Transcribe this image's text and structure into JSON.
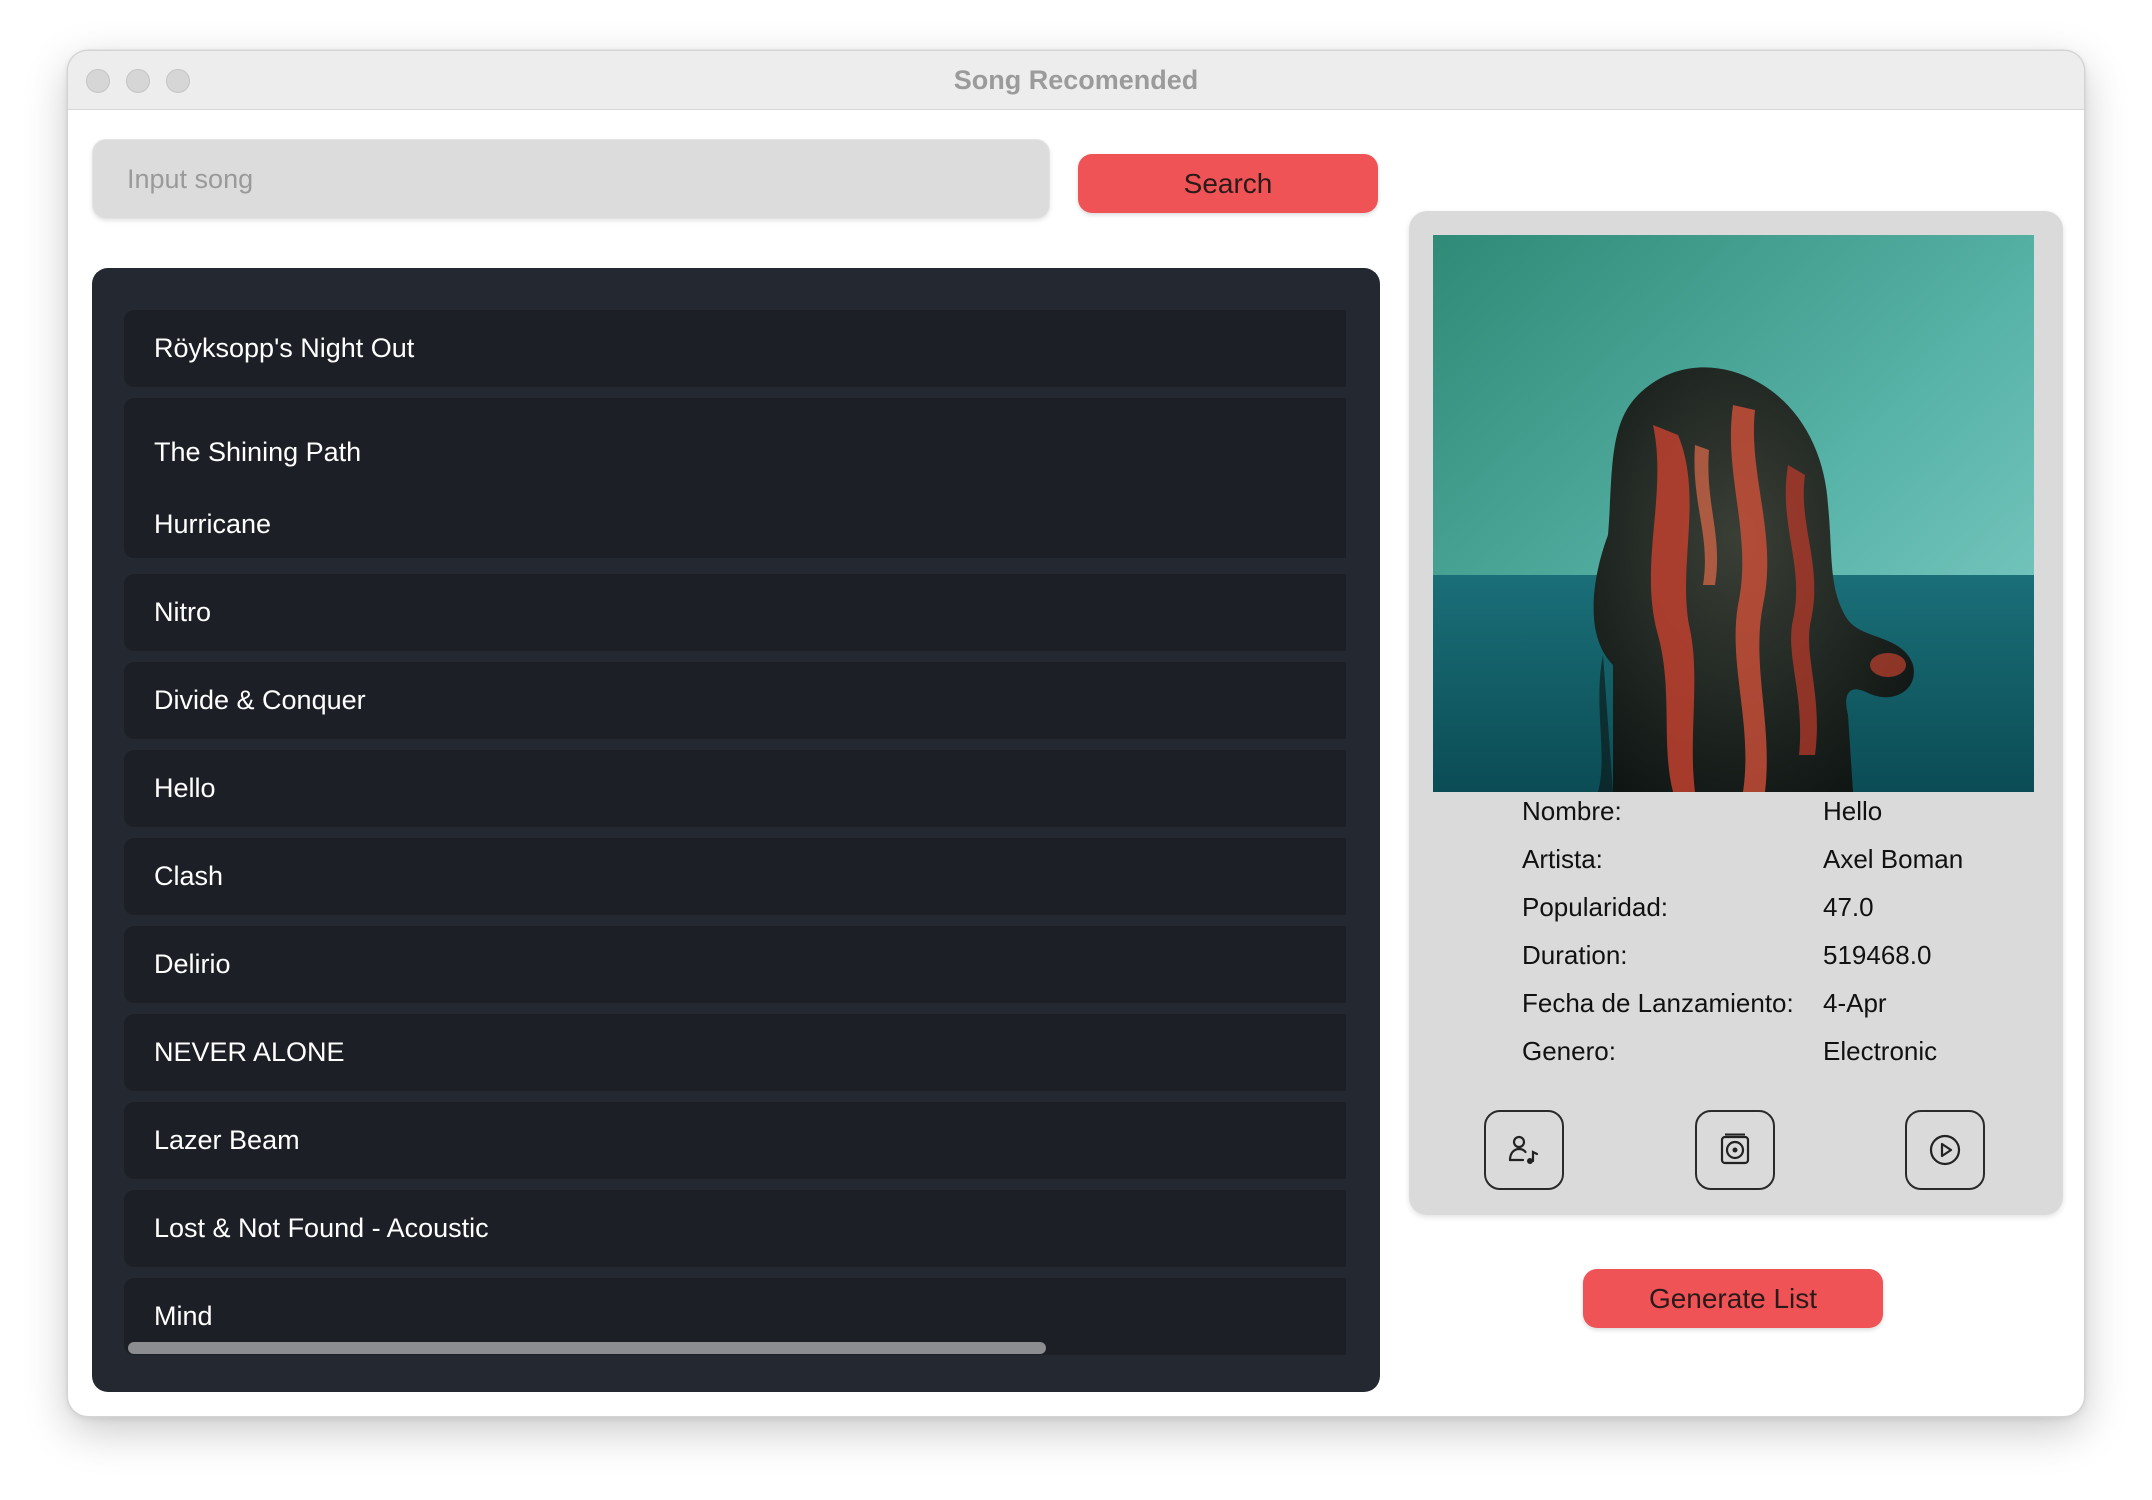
{
  "window": {
    "title": "Song Recomended"
  },
  "search": {
    "placeholder": "Input song",
    "value": "",
    "button_label": "Search"
  },
  "songs": [
    "Röyksopp's Night Out",
    "The Shining Path",
    "Hurricane",
    "Nitro",
    "Divide & Conquer",
    "Hello",
    "Clash",
    "Delirio",
    "NEVER ALONE",
    "Lazer Beam",
    "Lost & Not Found - Acoustic",
    "Mind"
  ],
  "details": {
    "rows": [
      {
        "label": "Nombre:",
        "value": "Hello"
      },
      {
        "label": "Artista:",
        "value": "Axel Boman"
      },
      {
        "label": "Popularidad:",
        "value": "47.0"
      },
      {
        "label": "Duration:",
        "value": "519468.0"
      },
      {
        "label": "Fecha de Lanzamiento:",
        "value": "4-Apr"
      },
      {
        "label": "Genero:",
        "value": "Electronic"
      }
    ],
    "icons": [
      "artist-music-icon",
      "album-icon",
      "play-icon"
    ]
  },
  "generate": {
    "label": "Generate List"
  },
  "colors": {
    "accent": "#f05356",
    "list_bg": "#232831",
    "item_bg": "#1c1f26",
    "panel_bg": "#dadada"
  }
}
